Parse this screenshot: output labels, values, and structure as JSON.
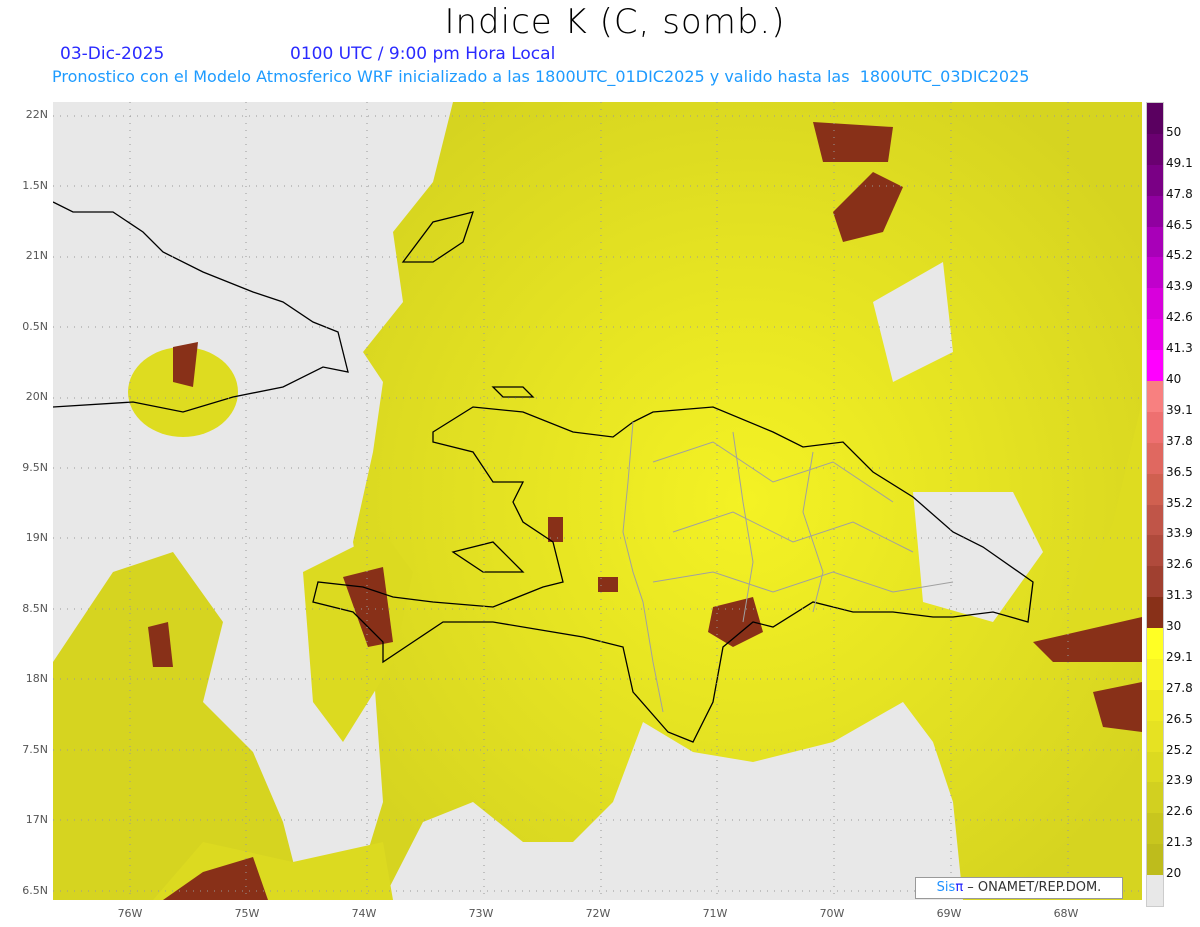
{
  "title": "Indice K (C, somb.)",
  "date": "03-Dic-2025",
  "time": "0100 UTC / 9:00 pm Hora Local",
  "description": "Pronostico con el Modelo Atmosferico WRF inicializado a las 1800UTC_01DIC2025 y valido hasta las  1800UTC_03DIC2025",
  "credit": {
    "brand": "Sis",
    "brand_symbol": "π",
    "text": "–  ONAMET/REP.DOM."
  },
  "y_axis_labels": [
    "22N",
    "1.5N",
    "21N",
    "0.5N",
    "20N",
    "9.5N",
    "19N",
    "8.5N",
    "18N",
    "7.5N",
    "17N",
    "6.5N"
  ],
  "x_axis_labels": [
    "76W",
    "75W",
    "74W",
    "73W",
    "72W",
    "71W",
    "70W",
    "69W",
    "68W"
  ],
  "colorbar": {
    "labels": [
      "50",
      "49.1",
      "47.8",
      "46.5",
      "45.2",
      "43.9",
      "42.6",
      "41.3",
      "40",
      "39.1",
      "37.8",
      "36.5",
      "35.2",
      "33.9",
      "32.6",
      "31.3",
      "30",
      "29.1",
      "27.8",
      "26.5",
      "25.2",
      "23.9",
      "22.6",
      "21.3",
      "20"
    ],
    "colors": [
      "#5a0060",
      "#6a0070",
      "#7a0085",
      "#9000a0",
      "#a800b8",
      "#c000cc",
      "#d800dc",
      "#e800e8",
      "#ff00ff",
      "#f88080",
      "#ee7070",
      "#e06860",
      "#d06050",
      "#c05548",
      "#b04a3c",
      "#a04030",
      "#883018",
      "#ffff24",
      "#f8f424",
      "#eeea22",
      "#e6e222",
      "#dcda20",
      "#d2d020",
      "#c8c61e",
      "#bebc1c",
      "#e8e8e8"
    ]
  },
  "colors": {
    "background": "#e8e8e8",
    "low": "#bebc1c",
    "high": "#f8f424",
    "brown": "#883018",
    "coast": "#000000",
    "borders": "#a0a0a0"
  }
}
